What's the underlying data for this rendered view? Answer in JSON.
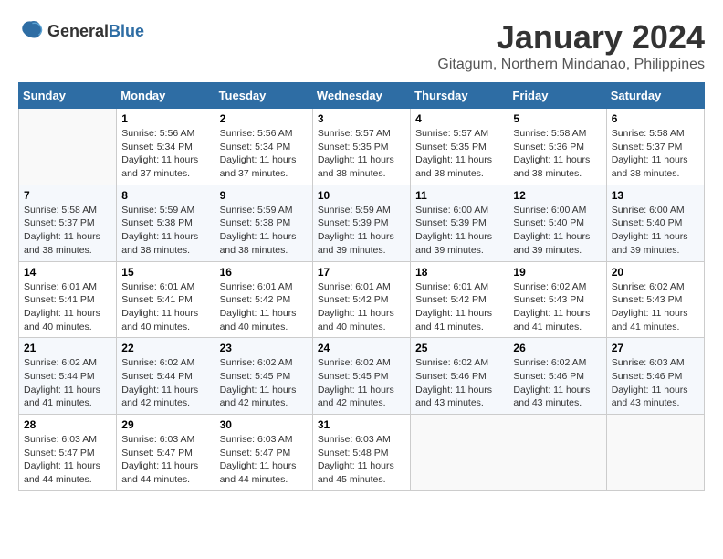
{
  "header": {
    "logo_general": "General",
    "logo_blue": "Blue",
    "month_year": "January 2024",
    "location": "Gitagum, Northern Mindanao, Philippines"
  },
  "weekdays": [
    "Sunday",
    "Monday",
    "Tuesday",
    "Wednesday",
    "Thursday",
    "Friday",
    "Saturday"
  ],
  "weeks": [
    [
      {
        "day": "",
        "sunrise": "",
        "sunset": "",
        "daylight": ""
      },
      {
        "day": "1",
        "sunrise": "Sunrise: 5:56 AM",
        "sunset": "Sunset: 5:34 PM",
        "daylight": "Daylight: 11 hours and 37 minutes."
      },
      {
        "day": "2",
        "sunrise": "Sunrise: 5:56 AM",
        "sunset": "Sunset: 5:34 PM",
        "daylight": "Daylight: 11 hours and 37 minutes."
      },
      {
        "day": "3",
        "sunrise": "Sunrise: 5:57 AM",
        "sunset": "Sunset: 5:35 PM",
        "daylight": "Daylight: 11 hours and 38 minutes."
      },
      {
        "day": "4",
        "sunrise": "Sunrise: 5:57 AM",
        "sunset": "Sunset: 5:35 PM",
        "daylight": "Daylight: 11 hours and 38 minutes."
      },
      {
        "day": "5",
        "sunrise": "Sunrise: 5:58 AM",
        "sunset": "Sunset: 5:36 PM",
        "daylight": "Daylight: 11 hours and 38 minutes."
      },
      {
        "day": "6",
        "sunrise": "Sunrise: 5:58 AM",
        "sunset": "Sunset: 5:37 PM",
        "daylight": "Daylight: 11 hours and 38 minutes."
      }
    ],
    [
      {
        "day": "7",
        "sunrise": "Sunrise: 5:58 AM",
        "sunset": "Sunset: 5:37 PM",
        "daylight": "Daylight: 11 hours and 38 minutes."
      },
      {
        "day": "8",
        "sunrise": "Sunrise: 5:59 AM",
        "sunset": "Sunset: 5:38 PM",
        "daylight": "Daylight: 11 hours and 38 minutes."
      },
      {
        "day": "9",
        "sunrise": "Sunrise: 5:59 AM",
        "sunset": "Sunset: 5:38 PM",
        "daylight": "Daylight: 11 hours and 38 minutes."
      },
      {
        "day": "10",
        "sunrise": "Sunrise: 5:59 AM",
        "sunset": "Sunset: 5:39 PM",
        "daylight": "Daylight: 11 hours and 39 minutes."
      },
      {
        "day": "11",
        "sunrise": "Sunrise: 6:00 AM",
        "sunset": "Sunset: 5:39 PM",
        "daylight": "Daylight: 11 hours and 39 minutes."
      },
      {
        "day": "12",
        "sunrise": "Sunrise: 6:00 AM",
        "sunset": "Sunset: 5:40 PM",
        "daylight": "Daylight: 11 hours and 39 minutes."
      },
      {
        "day": "13",
        "sunrise": "Sunrise: 6:00 AM",
        "sunset": "Sunset: 5:40 PM",
        "daylight": "Daylight: 11 hours and 39 minutes."
      }
    ],
    [
      {
        "day": "14",
        "sunrise": "Sunrise: 6:01 AM",
        "sunset": "Sunset: 5:41 PM",
        "daylight": "Daylight: 11 hours and 40 minutes."
      },
      {
        "day": "15",
        "sunrise": "Sunrise: 6:01 AM",
        "sunset": "Sunset: 5:41 PM",
        "daylight": "Daylight: 11 hours and 40 minutes."
      },
      {
        "day": "16",
        "sunrise": "Sunrise: 6:01 AM",
        "sunset": "Sunset: 5:42 PM",
        "daylight": "Daylight: 11 hours and 40 minutes."
      },
      {
        "day": "17",
        "sunrise": "Sunrise: 6:01 AM",
        "sunset": "Sunset: 5:42 PM",
        "daylight": "Daylight: 11 hours and 40 minutes."
      },
      {
        "day": "18",
        "sunrise": "Sunrise: 6:01 AM",
        "sunset": "Sunset: 5:42 PM",
        "daylight": "Daylight: 11 hours and 41 minutes."
      },
      {
        "day": "19",
        "sunrise": "Sunrise: 6:02 AM",
        "sunset": "Sunset: 5:43 PM",
        "daylight": "Daylight: 11 hours and 41 minutes."
      },
      {
        "day": "20",
        "sunrise": "Sunrise: 6:02 AM",
        "sunset": "Sunset: 5:43 PM",
        "daylight": "Daylight: 11 hours and 41 minutes."
      }
    ],
    [
      {
        "day": "21",
        "sunrise": "Sunrise: 6:02 AM",
        "sunset": "Sunset: 5:44 PM",
        "daylight": "Daylight: 11 hours and 41 minutes."
      },
      {
        "day": "22",
        "sunrise": "Sunrise: 6:02 AM",
        "sunset": "Sunset: 5:44 PM",
        "daylight": "Daylight: 11 hours and 42 minutes."
      },
      {
        "day": "23",
        "sunrise": "Sunrise: 6:02 AM",
        "sunset": "Sunset: 5:45 PM",
        "daylight": "Daylight: 11 hours and 42 minutes."
      },
      {
        "day": "24",
        "sunrise": "Sunrise: 6:02 AM",
        "sunset": "Sunset: 5:45 PM",
        "daylight": "Daylight: 11 hours and 42 minutes."
      },
      {
        "day": "25",
        "sunrise": "Sunrise: 6:02 AM",
        "sunset": "Sunset: 5:46 PM",
        "daylight": "Daylight: 11 hours and 43 minutes."
      },
      {
        "day": "26",
        "sunrise": "Sunrise: 6:02 AM",
        "sunset": "Sunset: 5:46 PM",
        "daylight": "Daylight: 11 hours and 43 minutes."
      },
      {
        "day": "27",
        "sunrise": "Sunrise: 6:03 AM",
        "sunset": "Sunset: 5:46 PM",
        "daylight": "Daylight: 11 hours and 43 minutes."
      }
    ],
    [
      {
        "day": "28",
        "sunrise": "Sunrise: 6:03 AM",
        "sunset": "Sunset: 5:47 PM",
        "daylight": "Daylight: 11 hours and 44 minutes."
      },
      {
        "day": "29",
        "sunrise": "Sunrise: 6:03 AM",
        "sunset": "Sunset: 5:47 PM",
        "daylight": "Daylight: 11 hours and 44 minutes."
      },
      {
        "day": "30",
        "sunrise": "Sunrise: 6:03 AM",
        "sunset": "Sunset: 5:47 PM",
        "daylight": "Daylight: 11 hours and 44 minutes."
      },
      {
        "day": "31",
        "sunrise": "Sunrise: 6:03 AM",
        "sunset": "Sunset: 5:48 PM",
        "daylight": "Daylight: 11 hours and 45 minutes."
      },
      {
        "day": "",
        "sunrise": "",
        "sunset": "",
        "daylight": ""
      },
      {
        "day": "",
        "sunrise": "",
        "sunset": "",
        "daylight": ""
      },
      {
        "day": "",
        "sunrise": "",
        "sunset": "",
        "daylight": ""
      }
    ]
  ]
}
